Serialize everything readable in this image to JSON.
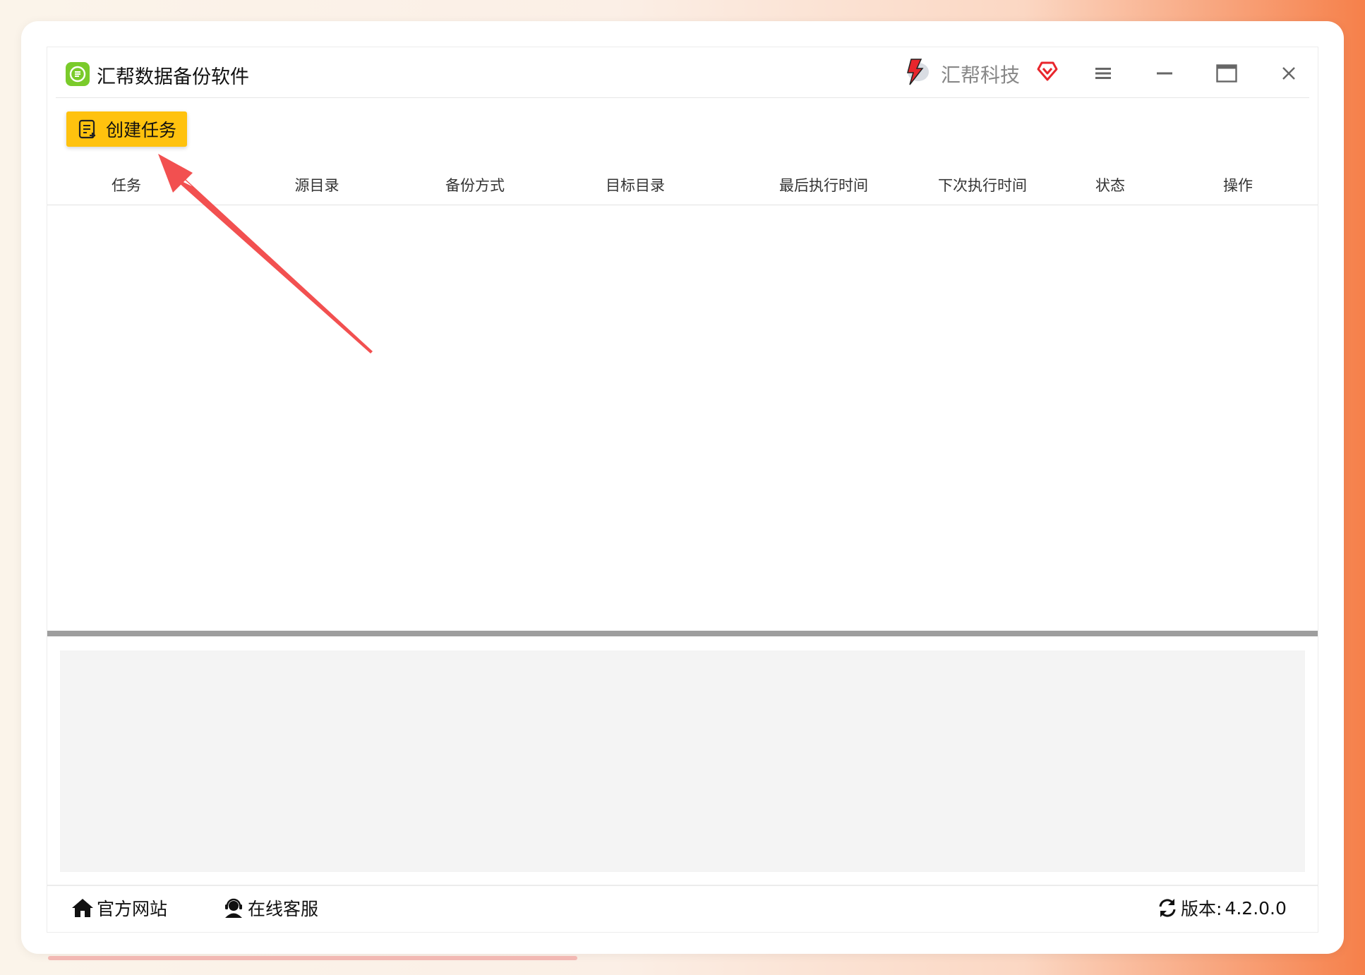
{
  "window": {
    "title": "汇帮数据备份软件",
    "brand": "汇帮科技"
  },
  "toolbar": {
    "create_task_label": "创建任务"
  },
  "table": {
    "columns": [
      "任务",
      "源目录",
      "备份方式",
      "目标目录",
      "最后执行时间",
      "下次执行时间",
      "状态",
      "操作"
    ],
    "rows": []
  },
  "footer": {
    "website_label": "官方网站",
    "service_label": "在线客服",
    "version_label": "版本:",
    "version_value": "4.2.0.0"
  },
  "colors": {
    "accent": "#ffc20e",
    "logo": "#7acb2b",
    "annotation_arrow": "#f25050",
    "brand_red": "#e8262c"
  },
  "icons": {
    "app": "green-chat-list-icon",
    "brand": "red-lightning-logo-icon",
    "vip": "red-heart-diamond-icon",
    "menu": "hamburger-icon",
    "minimize": "minimize-icon",
    "maximize": "maximize-icon",
    "close": "close-icon",
    "create": "document-add-icon",
    "website": "home-icon",
    "service": "headset-user-icon",
    "version": "refresh-icon"
  }
}
